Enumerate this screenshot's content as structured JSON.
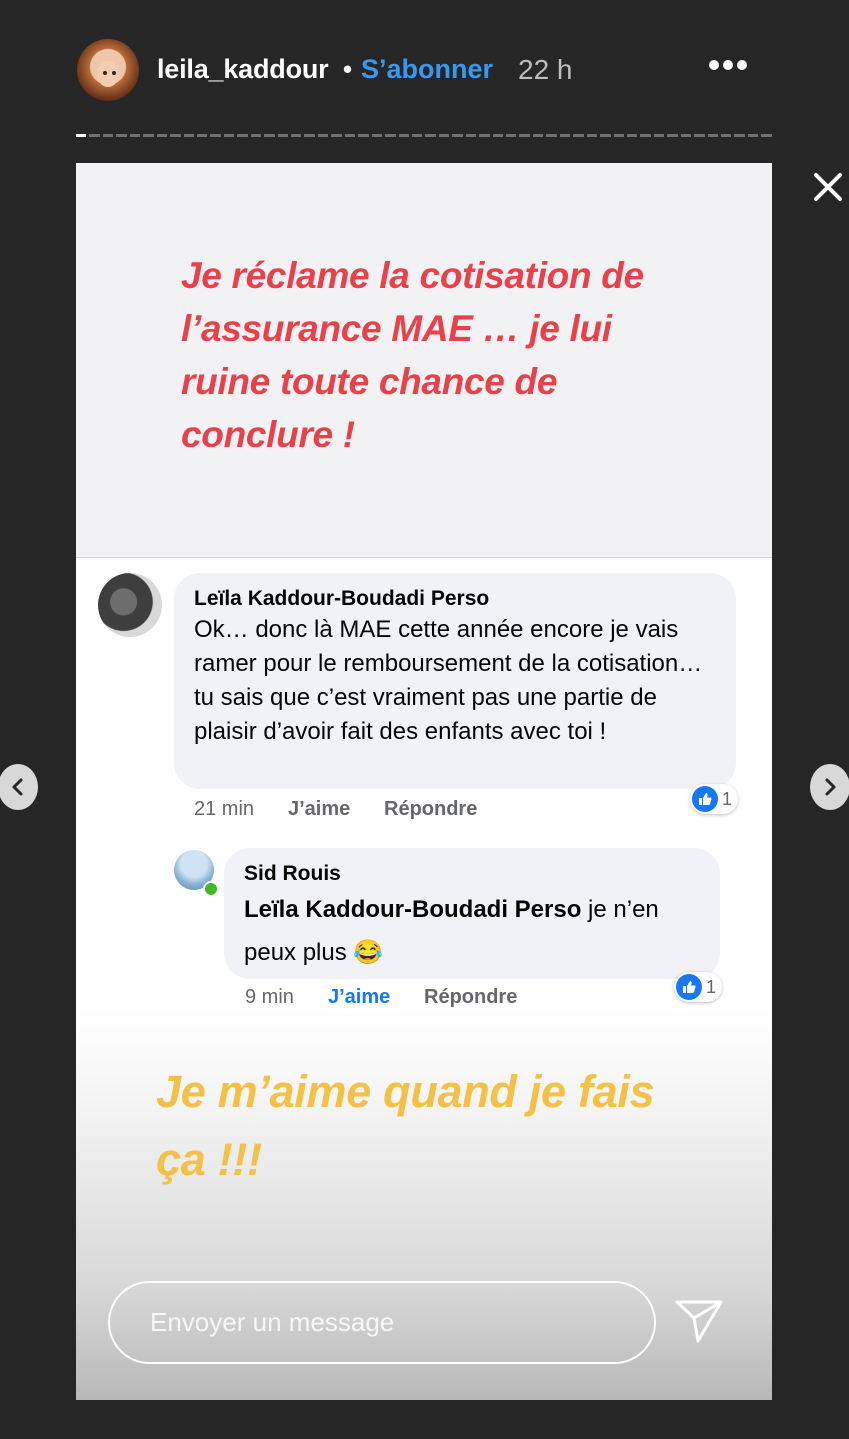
{
  "header": {
    "username": "leila_kaddour",
    "separator": "•",
    "follow_label": "S’abonner",
    "time": "22 h"
  },
  "story": {
    "top_text": "Je réclame la cotisation de l’assurance MAE … je lui ruine toute chance de conclure !",
    "comments": [
      {
        "author": "Leïla Kaddour-Boudadi Perso",
        "text": "Ok… donc là MAE cette année encore je vais ramer pour le remboursement de la cotisation… tu sais que c’est vraiment pas une partie de plaisir d’avoir fait des enfants avec toi !",
        "time": "21 min",
        "like_label": "J’aime",
        "reply_label": "Répondre",
        "reactions": "1"
      },
      {
        "author": "Sid Rouis",
        "mention": "Leïla Kaddour-Boudadi Perso",
        "text": "je n’en peux plus 😂",
        "time": "9 min",
        "like_label": "J’aime",
        "reply_label": "Répondre",
        "reactions": "1"
      }
    ],
    "bottom_text": "Je m’aime quand je fais ça !!!",
    "message_placeholder": "Envoyer un message"
  },
  "colors": {
    "red_caption": "#e8414a",
    "yellow_caption": "#f5c046",
    "follow_blue": "#3897f0",
    "fb_blue": "#1877f2"
  }
}
